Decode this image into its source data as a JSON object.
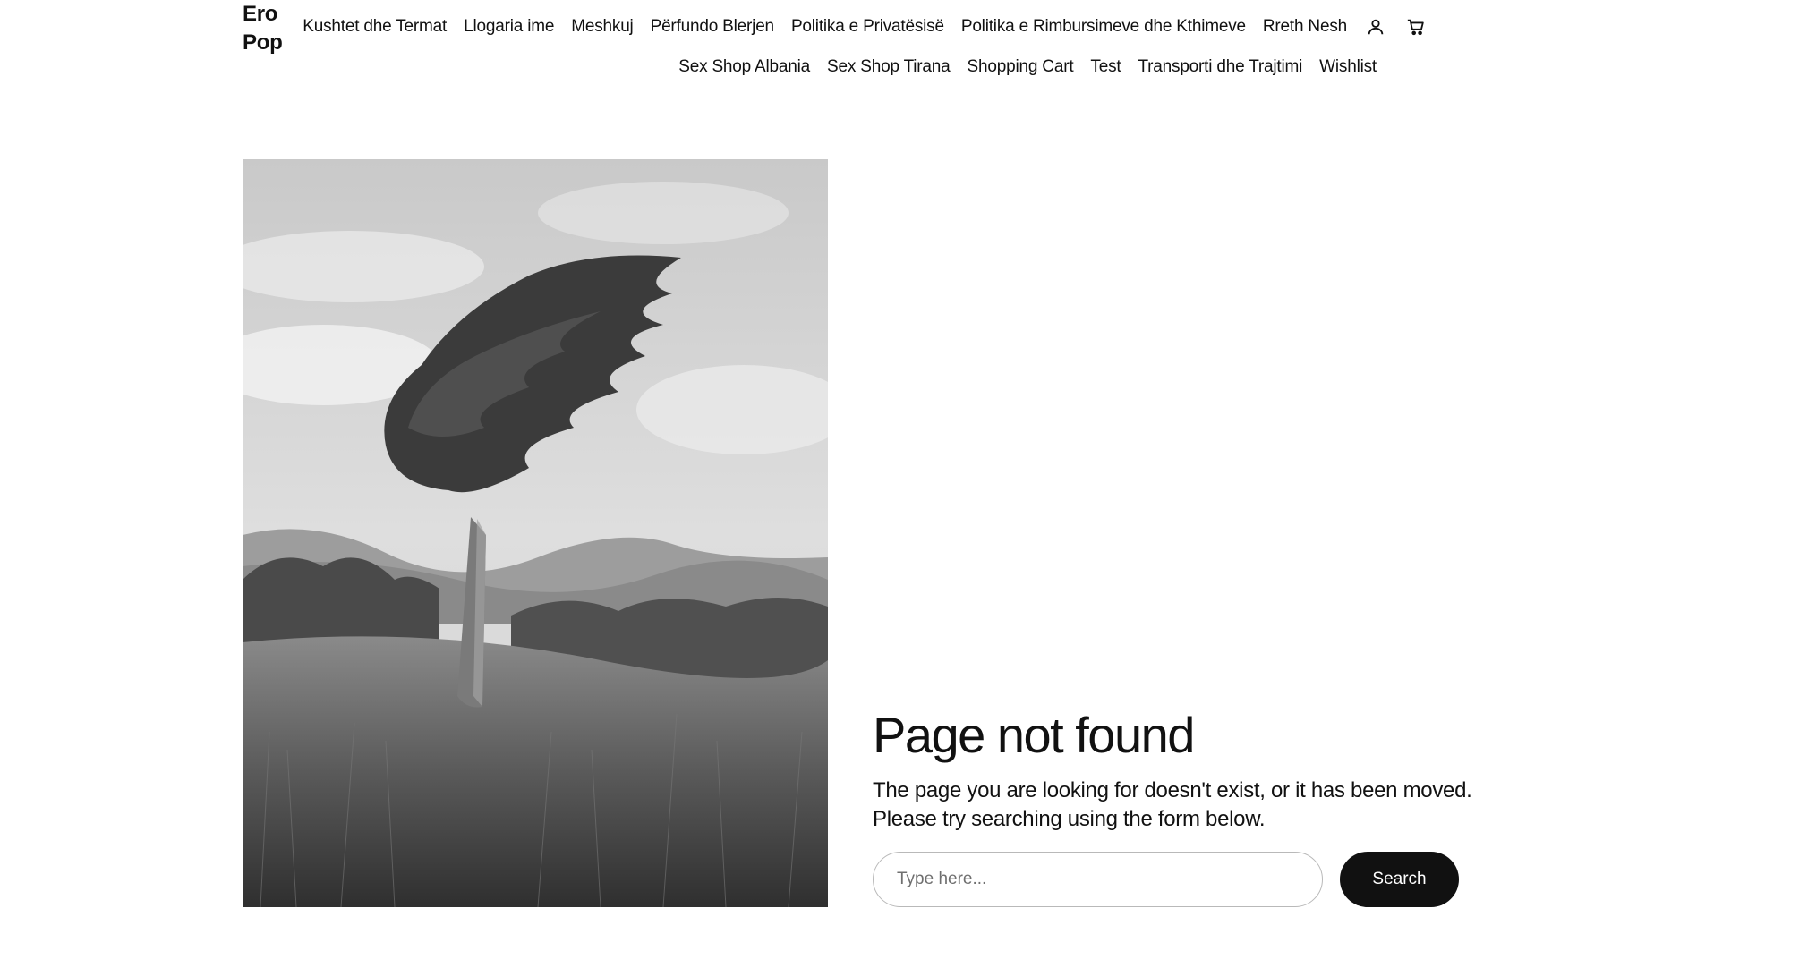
{
  "header": {
    "brand_line1": "Ero",
    "brand_line2": "Pop",
    "nav_row1": [
      "Kushtet dhe Termat",
      "Llogaria ime",
      "Meshkuj",
      "Përfundo Blerjen",
      "Politika e Privatësisë",
      "Politika e Rimbursimeve dhe Kthimeve",
      "Rreth Nesh"
    ],
    "nav_row2": [
      "Sex Shop Albania",
      "Sex Shop Tirana",
      "Shopping Cart",
      "Test",
      "Transporti dhe Trajtimi",
      "Wishlist"
    ],
    "icons": {
      "account": "user-icon",
      "cart": "cart-icon"
    }
  },
  "main": {
    "image_icon": "windswept-tree-photo",
    "title": "Page not found",
    "description_line1": "The page you are looking for doesn't exist, or it has been moved.",
    "description_line2": "Please try searching using the form below.",
    "search": {
      "placeholder": "Type here...",
      "value": "",
      "button_label": "Search"
    }
  },
  "colors": {
    "text": "#111111",
    "button_bg": "#111111",
    "button_text": "#ffffff",
    "input_border": "#b9b9b9"
  }
}
